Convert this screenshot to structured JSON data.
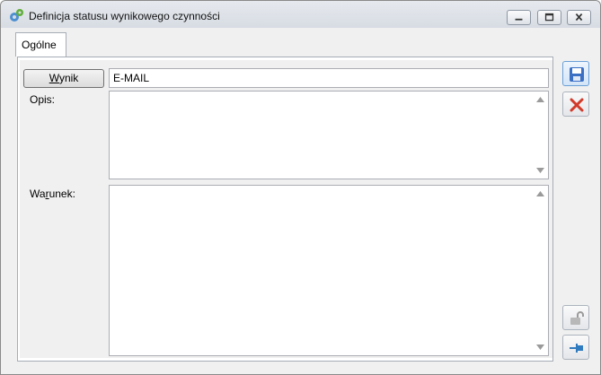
{
  "window": {
    "title": "Definicja statusu wynikowego czynności",
    "controls": [
      "minimize-icon",
      "maximize-icon",
      "close-icon"
    ]
  },
  "tabs": [
    {
      "label": "Ogólne",
      "active": true
    }
  ],
  "form": {
    "wynik_button_label": "Wynik",
    "wynik_value": "E-MAIL",
    "opis_label": "Opis:",
    "opis_value": "",
    "warunek_label": "Warunek:",
    "warunek_value": ""
  },
  "side_buttons": [
    {
      "icon": "save-icon",
      "color": "#3a6fc4"
    },
    {
      "icon": "cancel-icon",
      "color": "#d23a2a"
    },
    {
      "icon": "unlock-icon",
      "color": "#9a9a9a"
    },
    {
      "icon": "pin-icon",
      "color": "#2f7bbf"
    }
  ]
}
